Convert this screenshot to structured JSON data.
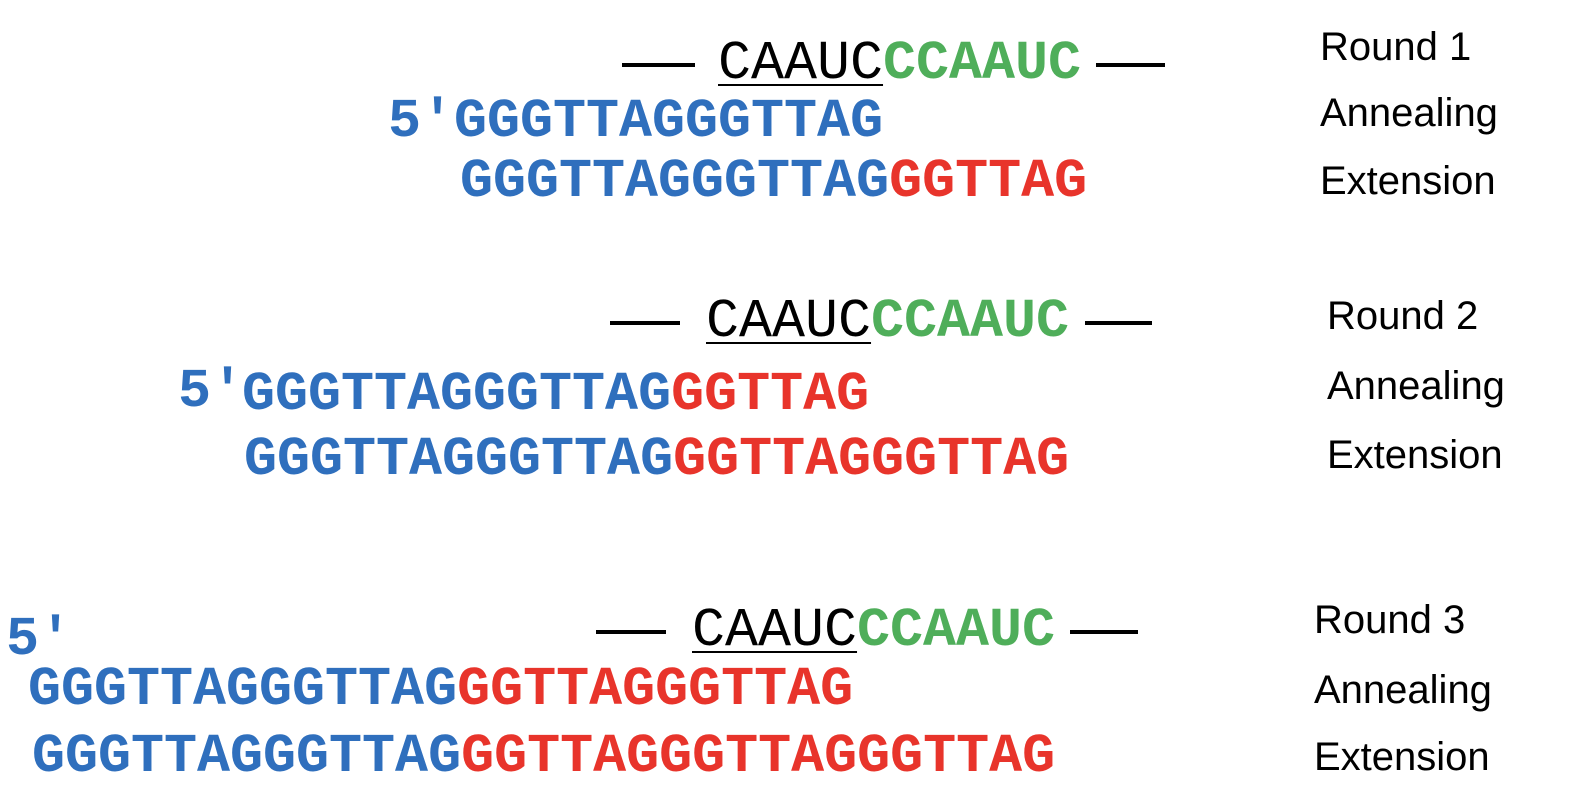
{
  "colors": {
    "template": "#000000",
    "template_new": "#4fae5a",
    "primer": "#2f6fbd",
    "added": "#e8342b"
  },
  "rounds": [
    {
      "label": "Round 1",
      "annealing_label": "Annealing",
      "extension_label": "Extension",
      "template": {
        "underlined": "CAAUC",
        "highlight": "CCAAUC"
      },
      "annealing": {
        "prime": "5′",
        "blue": "GGGTTAGGGTTAG",
        "red": ""
      },
      "extension": {
        "blue": "GGGTTAGGGTTAG",
        "red": "GGTTAG"
      }
    },
    {
      "label": "Round 2",
      "annealing_label": "Annealing",
      "extension_label": "Extension",
      "template": {
        "underlined": "CAAUC",
        "highlight": "CCAAUC"
      },
      "annealing": {
        "prime": "5′",
        "blue": "GGGTTAGGGTTAG",
        "red": "GGTTAG"
      },
      "extension": {
        "blue": "GGGTTAGGGTTAG",
        "red": "GGTTAGGGTTAG"
      }
    },
    {
      "label": "Round 3",
      "annealing_label": "Annealing",
      "extension_label": "Extension",
      "template": {
        "underlined": "CAAUC",
        "highlight": "CCAAUC"
      },
      "annealing": {
        "prime": "5′",
        "blue": "GGGTTAGGGTTAG",
        "red": "GGTTAGGGTTAG"
      },
      "extension": {
        "blue": "GGGTTAGGGTTAG",
        "red": "GGTTAGGGTTAGGGTTAG"
      }
    }
  ]
}
